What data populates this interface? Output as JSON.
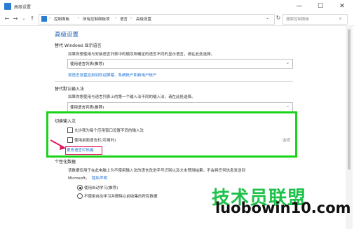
{
  "window": {
    "title": "高级设置",
    "minimize": "—",
    "maximize": "☐",
    "close": "✕"
  },
  "nav": {
    "back": "←",
    "forward": "→",
    "dropdown": "⌄",
    "up": "↑"
  },
  "breadcrumb": [
    "控制面板",
    "所有控制面板项",
    "语言",
    "高级设置"
  ],
  "search": {
    "placeholder": "搜索控制面板"
  },
  "page": {
    "title": "高级设置",
    "display_language": {
      "heading": "替代 Windows 显示语言",
      "description": "如果你想使用与安装语言列表中的顺序所确定的语言不同的显示语言，请在此处选择。",
      "value": "使用语言列表(推荐)",
      "link": "将语言设置应用到欢迎屏幕、系统帐户和新用户帐户"
    },
    "default_input": {
      "heading": "替代默认输入法",
      "description": "如果你想使用与语言列表上的第一个输入法不同的输入法，请在此处选择。",
      "value": "使用语言列表(推荐)"
    },
    "switch_input": {
      "heading": "切换输入法",
      "option1": "允许我为每个应用窗口设置不同的输入法",
      "option2": "使用桌面语言栏(可用时)",
      "options_link": "选项",
      "hotkey_link": "更改语言栏热键"
    },
    "personalization": {
      "heading": "个性化数据",
      "description_line1": "该数据仅用于在此电脑上为不使用输入法的语言改进手写识别以及文本预测结果。不会将任何信息发送到",
      "description_line2": "Microsoft。",
      "privacy_link": "隐私声明",
      "radio1": "使用自动学习(推荐)",
      "radio2": "不使用自动学习并删除以前收集的所有数据"
    }
  },
  "watermark": {
    "line1": "技术员联盟",
    "line2": "luobowin10.com"
  }
}
